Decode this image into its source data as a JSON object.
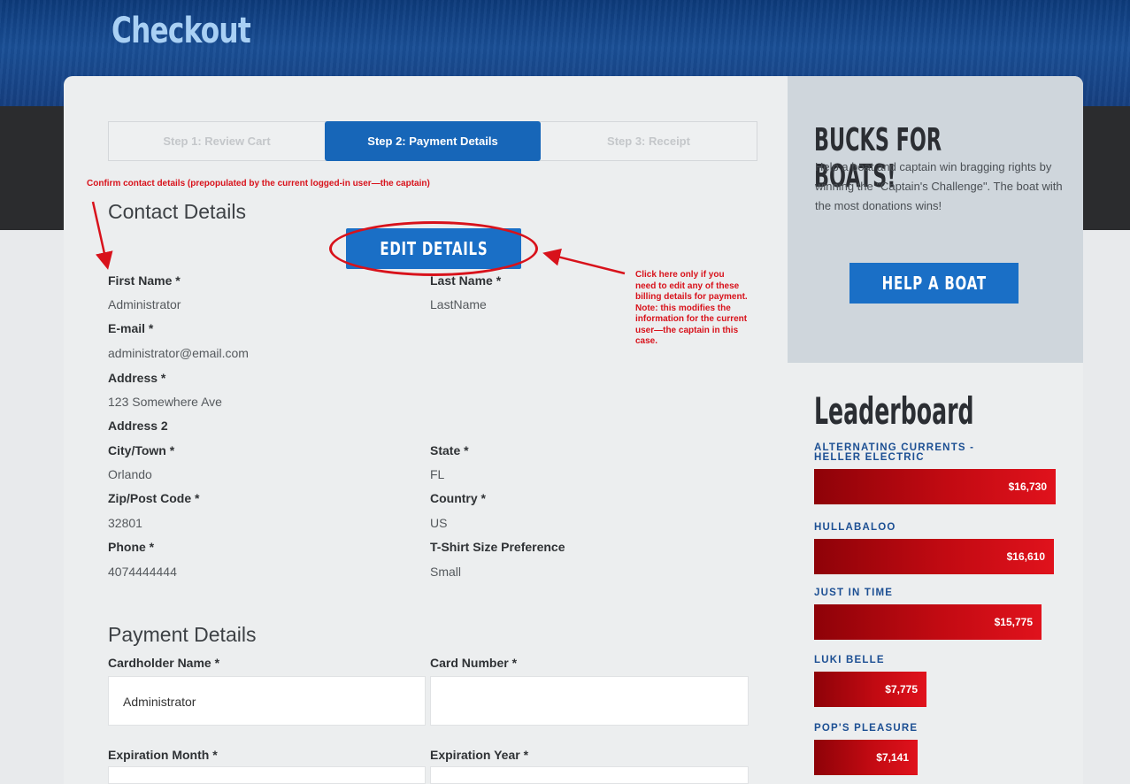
{
  "header": {
    "title": "Checkout"
  },
  "steps": [
    {
      "label": "Step 1: Review Cart",
      "active": false
    },
    {
      "label": "Step 2: Payment Details",
      "active": true
    },
    {
      "label": "Step 3: Receipt",
      "active": false
    }
  ],
  "annotations": {
    "contact_note": "Confirm contact details (prepopulated by the current logged-in user—the captain)",
    "edit_note_lines": [
      "Click here only if you",
      "need to edit any of these",
      "billing details for payment.",
      "Note: this modifies the",
      "information for the current",
      "user—the captain in this",
      "case."
    ]
  },
  "contact": {
    "title": "Contact Details",
    "edit_button": "EDIT DETAILS",
    "first_name_label": "First Name *",
    "first_name": "Administrator",
    "last_name_label": "Last Name *",
    "last_name": "LastName",
    "email_label": "E-mail *",
    "email": "administrator@email.com",
    "address_label": "Address *",
    "address": "123 Somewhere Ave",
    "address2_label": "Address 2",
    "city_label": "City/Town *",
    "city": "Orlando",
    "state_label": "State *",
    "state": "FL",
    "zip_label": "Zip/Post Code *",
    "zip": "32801",
    "country_label": "Country *",
    "country": "US",
    "phone_label": "Phone *",
    "phone": "4074444444",
    "tshirt_label": "T-Shirt Size Preference",
    "tshirt": "Small"
  },
  "payment": {
    "title": "Payment Details",
    "cardholder_label": "Cardholder Name *",
    "cardholder_value": "Administrator",
    "card_number_label": "Card Number *",
    "card_number_value": "",
    "exp_month_label": "Expiration Month *",
    "exp_year_label": "Expiration Year *"
  },
  "sidebar": {
    "promo_title": "BUCKS FOR BOATS!",
    "promo_text": "Help a boat and captain win bragging rights by winning the \"Captain's Challenge\". The boat with the most donations wins!",
    "help_button": "HELP A BOAT",
    "leaderboard_title": "Leaderboard",
    "leaderboard": [
      {
        "name_lines": [
          "ALTERNATING CURRENTS -",
          "HELLER ELECTRIC"
        ],
        "amount": "$16,730",
        "fraction": 1.0
      },
      {
        "name_lines": [
          "HULLABALOO"
        ],
        "amount": "$16,610",
        "fraction": 0.993
      },
      {
        "name_lines": [
          "JUST IN TIME"
        ],
        "amount": "$15,775",
        "fraction": 0.943
      },
      {
        "name_lines": [
          "LUKI BELLE"
        ],
        "amount": "$7,775",
        "fraction": 0.465
      },
      {
        "name_lines": [
          "POP'S PLEASURE"
        ],
        "amount": "$7,141",
        "fraction": 0.427
      }
    ]
  },
  "colors": {
    "primary_blue": "#1a6fc6",
    "annotation_red": "#d8121b",
    "bar_red": "#c20a12"
  }
}
